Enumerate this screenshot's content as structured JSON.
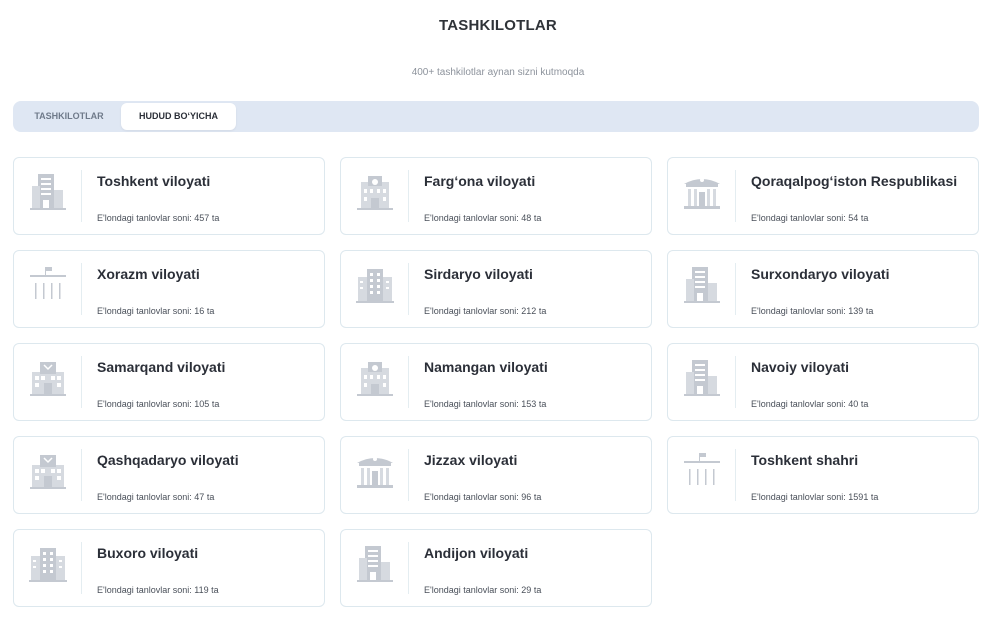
{
  "header": {
    "title": "TASHKILOTLAR",
    "subtitle": "400+ tashkilotlar aynan sizni kutmoqda"
  },
  "tabs": [
    {
      "label": "TASHKILOTLAR",
      "active": false
    },
    {
      "label": "HUDUD BO‘YICHA",
      "active": true
    }
  ],
  "count_label": "E'londagi tanlovlar soni:",
  "count_unit": "ta",
  "colors": {
    "accent_tabbar": "#dfe7f3",
    "icon_gray": "#c4c9d1",
    "card_border": "#dde8ee"
  },
  "regions": [
    {
      "name": "Toshkent viloyati",
      "count": 457,
      "icon": "office-building-icon"
    },
    {
      "name": "Farg‘ona viloyati",
      "count": 48,
      "icon": "government-building-icon"
    },
    {
      "name": "Qoraqalpog‘iston Respublikasi",
      "count": 54,
      "icon": "museum-building-icon"
    },
    {
      "name": "Xorazm viloyati",
      "count": 16,
      "icon": "columns-building-icon"
    },
    {
      "name": "Sirdaryo viloyati",
      "count": 212,
      "icon": "apartment-building-icon"
    },
    {
      "name": "Surxondaryo viloyati",
      "count": 139,
      "icon": "office-building-icon"
    },
    {
      "name": "Samarqand viloyati",
      "count": 105,
      "icon": "school-building-icon"
    },
    {
      "name": "Namangan viloyati",
      "count": 153,
      "icon": "government-building-icon"
    },
    {
      "name": "Navoiy viloyati",
      "count": 40,
      "icon": "office-building-icon"
    },
    {
      "name": "Qashqadaryo viloyati",
      "count": 47,
      "icon": "school-building-icon"
    },
    {
      "name": "Jizzax viloyati",
      "count": 96,
      "icon": "museum-building-icon"
    },
    {
      "name": "Toshkent shahri",
      "count": 1591,
      "icon": "columns-building-icon"
    },
    {
      "name": "Buxoro viloyati",
      "count": 119,
      "icon": "apartment-building-icon"
    },
    {
      "name": "Andijon viloyati",
      "count": 29,
      "icon": "office-building-icon"
    }
  ]
}
